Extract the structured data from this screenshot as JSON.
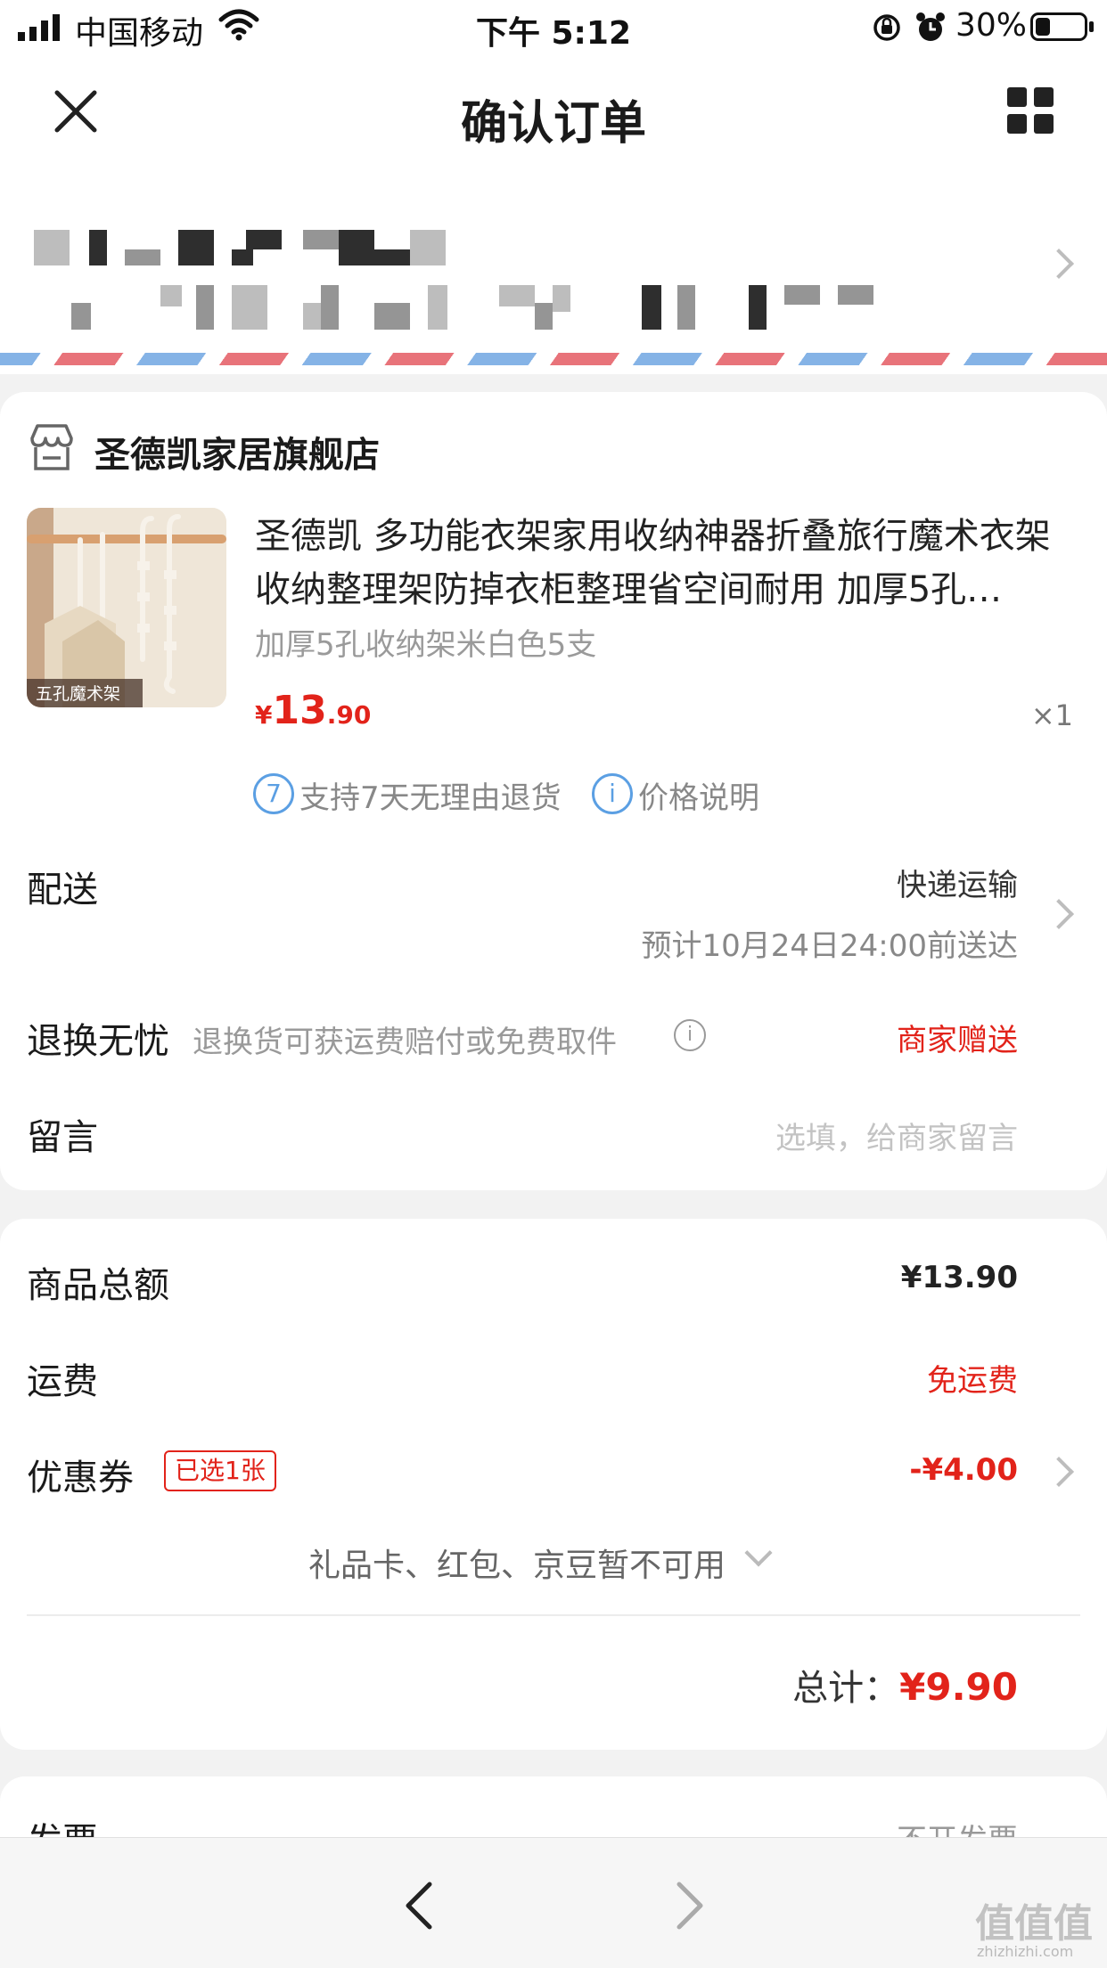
{
  "status_bar": {
    "carrier": "中国移动",
    "time": "下午 5:12",
    "battery": "30%",
    "battery_level": 0.3
  },
  "nav": {
    "title": "确认订单",
    "close_icon": "close-icon",
    "menu_icon": "grid-icon"
  },
  "address": {
    "masked": true
  },
  "shop": {
    "name": "圣德凯家居旗舰店",
    "icon": "store-icon"
  },
  "product": {
    "title": "圣德凯 多功能衣架家用收纳神器折叠旅行魔术衣架收纳整理架防掉衣柜整理省空间耐用 加厚5孔…",
    "sku": "加厚5孔收纳架米白色5支",
    "image_label": "五孔魔术架",
    "price_symbol": "¥",
    "price_int": "13",
    "price_dec": ".90",
    "quantity": "×1",
    "service_return_num": "7",
    "service_return": "支持7天无理由退货",
    "service_price_icon": "i",
    "service_price": "价格说明"
  },
  "delivery": {
    "label": "配送",
    "method": "快递运输",
    "estimate": "预计10月24日24:00前送达"
  },
  "returns": {
    "label": "退换无忧",
    "desc": "退换货可获运费赔付或免费取件",
    "value": "商家赠送"
  },
  "message": {
    "label": "留言",
    "placeholder": "选填，给商家留言"
  },
  "summary": {
    "goods_label": "商品总额",
    "goods_value": "¥13.90",
    "shipping_label": "运费",
    "shipping_value": "免运费",
    "coupon_label": "优惠券",
    "coupon_badge": "已选1张",
    "coupon_value": "-¥4.00",
    "unavailable": "礼品卡、红包、京豆暂不可用",
    "total_label": "总计：",
    "total_value": "¥9.90"
  },
  "invoice": {
    "label": "发票",
    "value": "不开发票"
  },
  "bottom_nav": {
    "back_icon": "back-arrow-icon",
    "forward_icon": "forward-arrow-icon"
  },
  "watermark": {
    "text": "值值值",
    "url_text": "zhizhizhi.com"
  },
  "colors": {
    "accent_red": "#e2231a",
    "service_blue": "#5b9fe3",
    "background": "#f2f2f2"
  }
}
